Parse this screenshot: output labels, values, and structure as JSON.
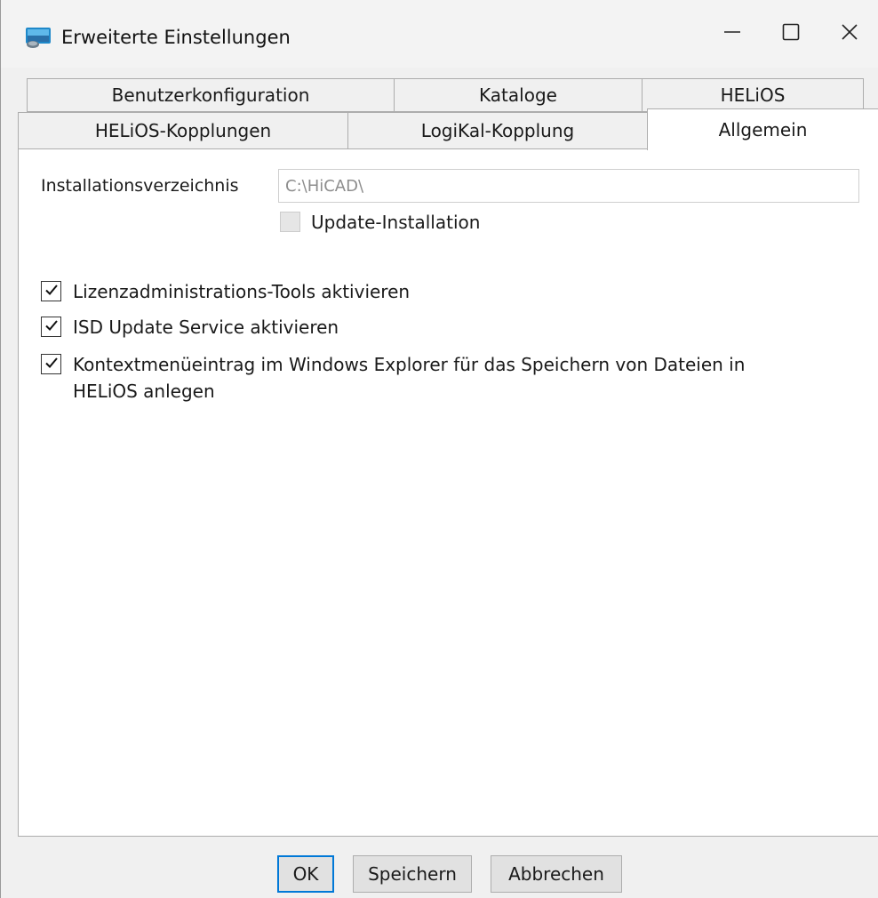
{
  "window": {
    "title": "Erweiterte Einstellungen",
    "app_icon": "app-icon",
    "controls": [
      "minimize-icon",
      "maximize-icon",
      "close-icon"
    ]
  },
  "tabs": {
    "row_back": [
      {
        "label": "Benutzerkonfiguration"
      },
      {
        "label": "Kataloge"
      },
      {
        "label": "HELiOS"
      }
    ],
    "row_front": [
      {
        "label": "HELiOS-Kopplungen"
      },
      {
        "label": "LogiKal-Kopplung"
      },
      {
        "label": "Allgemein",
        "active": true
      }
    ]
  },
  "general": {
    "install_dir_label": "Installationsverzeichnis",
    "install_dir_value": "C:\\HiCAD\\",
    "update_install": {
      "label": "Update-Installation",
      "checked": false,
      "enabled": false
    },
    "options": [
      {
        "label": "Lizenzadministrations-Tools aktivieren",
        "checked": true
      },
      {
        "label": "ISD Update Service aktivieren",
        "checked": true
      },
      {
        "label": "Kontextmenüeintrag im Windows Explorer für das Speichern von Dateien in HELiOS anlegen",
        "checked": true
      }
    ]
  },
  "buttons": {
    "ok": "OK",
    "save": "Speichern",
    "cancel": "Abbrechen"
  },
  "colors": {
    "accent": "#0078d7",
    "panel_bg": "#ffffff",
    "window_bg": "#f0f0f0"
  }
}
